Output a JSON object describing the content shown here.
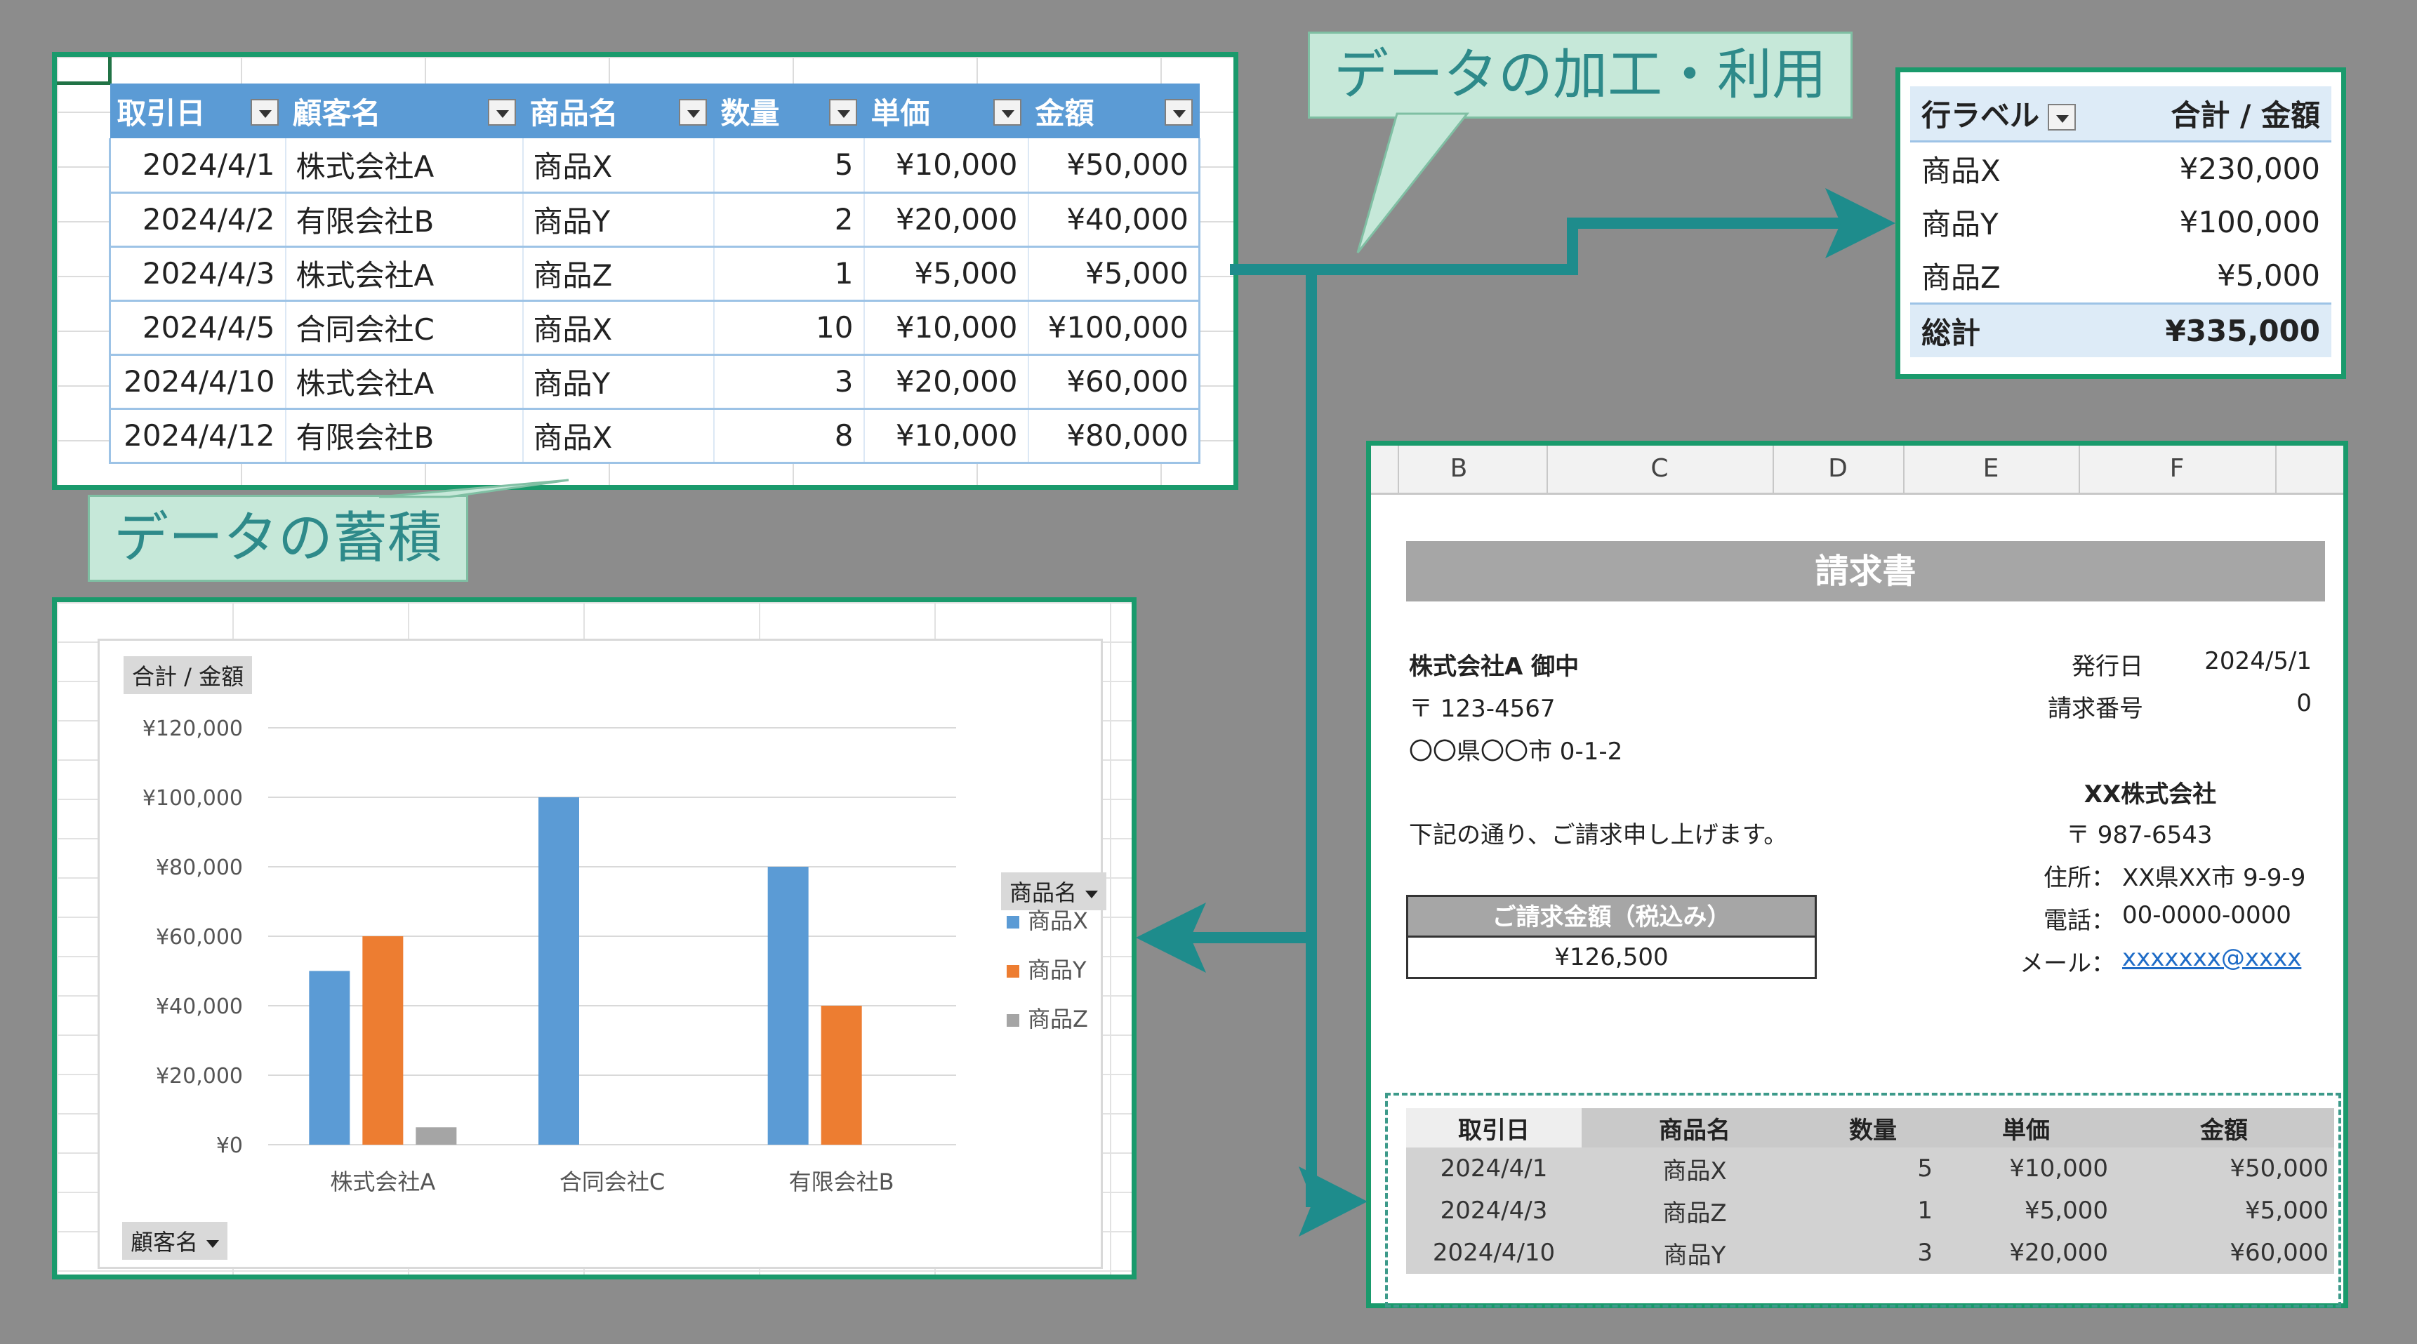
{
  "source_table": {
    "headers": [
      "取引日",
      "顧客名",
      "商品名",
      "数量",
      "単価",
      "金額"
    ],
    "rows": [
      [
        "2024/4/1",
        "株式会社A",
        "商品X",
        "5",
        "¥10,000",
        "¥50,000"
      ],
      [
        "2024/4/2",
        "有限会社B",
        "商品Y",
        "2",
        "¥20,000",
        "¥40,000"
      ],
      [
        "2024/4/3",
        "株式会社A",
        "商品Z",
        "1",
        "¥5,000",
        "¥5,000"
      ],
      [
        "2024/4/5",
        "合同会社C",
        "商品X",
        "10",
        "¥10,000",
        "¥100,000"
      ],
      [
        "2024/4/10",
        "株式会社A",
        "商品Y",
        "3",
        "¥20,000",
        "¥60,000"
      ],
      [
        "2024/4/12",
        "有限会社B",
        "商品X",
        "8",
        "¥10,000",
        "¥80,000"
      ]
    ]
  },
  "callouts": {
    "top": "データの加工・利用",
    "bottom": "データの蓄積"
  },
  "pivot": {
    "headers": [
      "行ラベル",
      "合計 / 金額"
    ],
    "rows": [
      [
        "商品X",
        "¥230,000"
      ],
      [
        "商品Y",
        "¥100,000"
      ],
      [
        "商品Z",
        "¥5,000"
      ]
    ],
    "total_label": "総計",
    "total_value": "¥335,000"
  },
  "chart_data": {
    "type": "bar",
    "value_field": "合計 / 金額",
    "row_field": "顧客名",
    "legend_field": "商品名",
    "categories": [
      "株式会社A",
      "合同会社C",
      "有限会社B"
    ],
    "series": [
      {
        "name": "商品X",
        "color": "#5b9bd5",
        "values": [
          50000,
          100000,
          80000
        ]
      },
      {
        "name": "商品Y",
        "color": "#ed7d31",
        "values": [
          60000,
          0,
          40000
        ]
      },
      {
        "name": "商品Z",
        "color": "#a5a5a5",
        "values": [
          5000,
          0,
          0
        ]
      }
    ],
    "ylim": [
      0,
      120000
    ],
    "yticks": [
      "¥0",
      "¥20,000",
      "¥40,000",
      "¥60,000",
      "¥80,000",
      "¥100,000",
      "¥120,000"
    ],
    "grid": true,
    "legend_position": "right"
  },
  "invoice": {
    "columns": [
      "B",
      "C",
      "D",
      "E",
      "F"
    ],
    "title": "請求書",
    "recipient": "株式会社A 御中",
    "recipient_zip": "〒 123-4567",
    "recipient_address": "〇〇県〇〇市 0-1-2",
    "intro": "下記の通り、ご請求申し上げます。",
    "issue_date_label": "発行日",
    "issue_date": "2024/5/1",
    "invoice_no_label": "請求番号",
    "invoice_no": "0",
    "sender": "XX株式会社",
    "sender_zip": "〒 987-6543",
    "sender_address_label": "住所：",
    "sender_address": "XX県XX市 9-9-9",
    "sender_tel_label": "電話：",
    "sender_tel": "00-0000-0000",
    "sender_mail_label": "メール：",
    "sender_mail": "xxxxxxx@xxxx",
    "amount_label": "ご請求金額（税込み）",
    "amount_value": "¥126,500",
    "table_headers": [
      "取引日",
      "商品名",
      "数量",
      "単価",
      "金額"
    ],
    "table_rows": [
      [
        "2024/4/1",
        "商品X",
        "5",
        "¥10,000",
        "¥50,000"
      ],
      [
        "2024/4/3",
        "商品Z",
        "1",
        "¥5,000",
        "¥5,000"
      ],
      [
        "2024/4/10",
        "商品Y",
        "3",
        "¥20,000",
        "¥60,000"
      ]
    ]
  },
  "colors": {
    "background": "#8c8c8c",
    "frame": "#1a9a6c",
    "arrow": "#1e8c8c",
    "table_header": "#5b9bd5"
  }
}
